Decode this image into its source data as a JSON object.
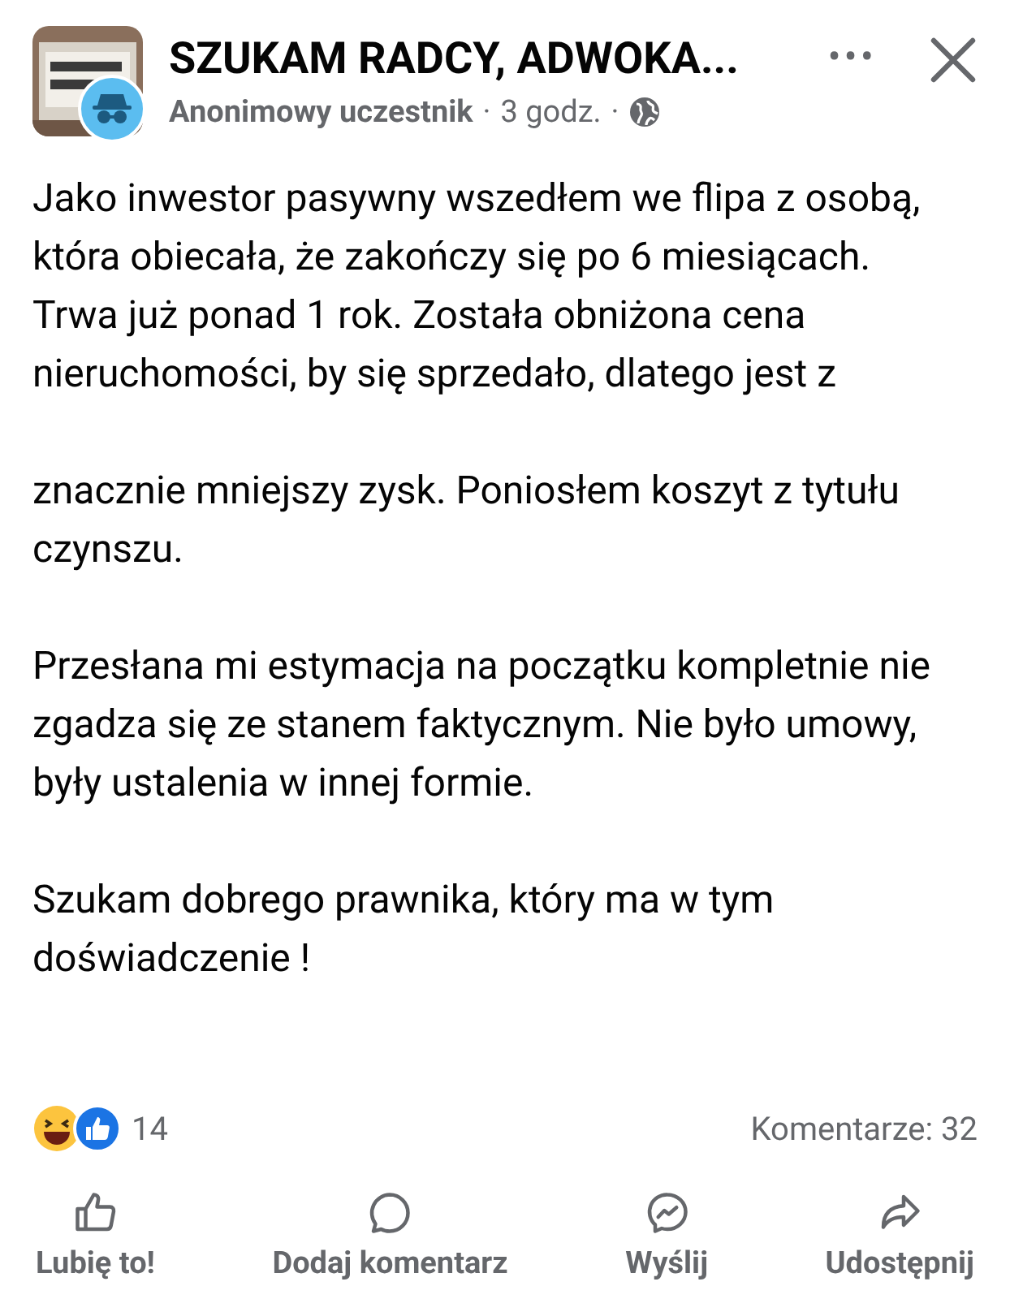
{
  "header": {
    "group_name": "SZUKAM RADCY, ADWOKA...",
    "author": "Anonimowy uczestnik",
    "separator_1": "·",
    "time": "3 godz.",
    "separator_2": "·",
    "more": "•••"
  },
  "paragraphs": [
    "Jako inwestor pasywny wszedłem we flipa z osobą, która obiecała, że zakończy się po 6 miesiącach. Trwa już ponad 1 rok. Została obniżona cena nieruchomości, by się sprzedało, dlatego jest z",
    "znacznie mniejszy zysk. Poniosłem koszyt z tytułu czynszu.",
    "Przesłana mi estymacja na początku kompletnie nie zgadza się ze stanem faktycznym. Nie było umowy, były ustalenia w innej formie.",
    "Szukam dobrego prawnika, który ma w tym doświadczenie !"
  ],
  "stats": {
    "reactions": "14",
    "comments": "Komentarze: 32"
  },
  "actions": [
    {
      "kind": "like",
      "label": "Lubię to!"
    },
    {
      "kind": "comment",
      "label": "Dodaj komentarz"
    },
    {
      "kind": "send",
      "label": "Wyślij"
    },
    {
      "kind": "share",
      "label": "Udostępnij"
    }
  ]
}
